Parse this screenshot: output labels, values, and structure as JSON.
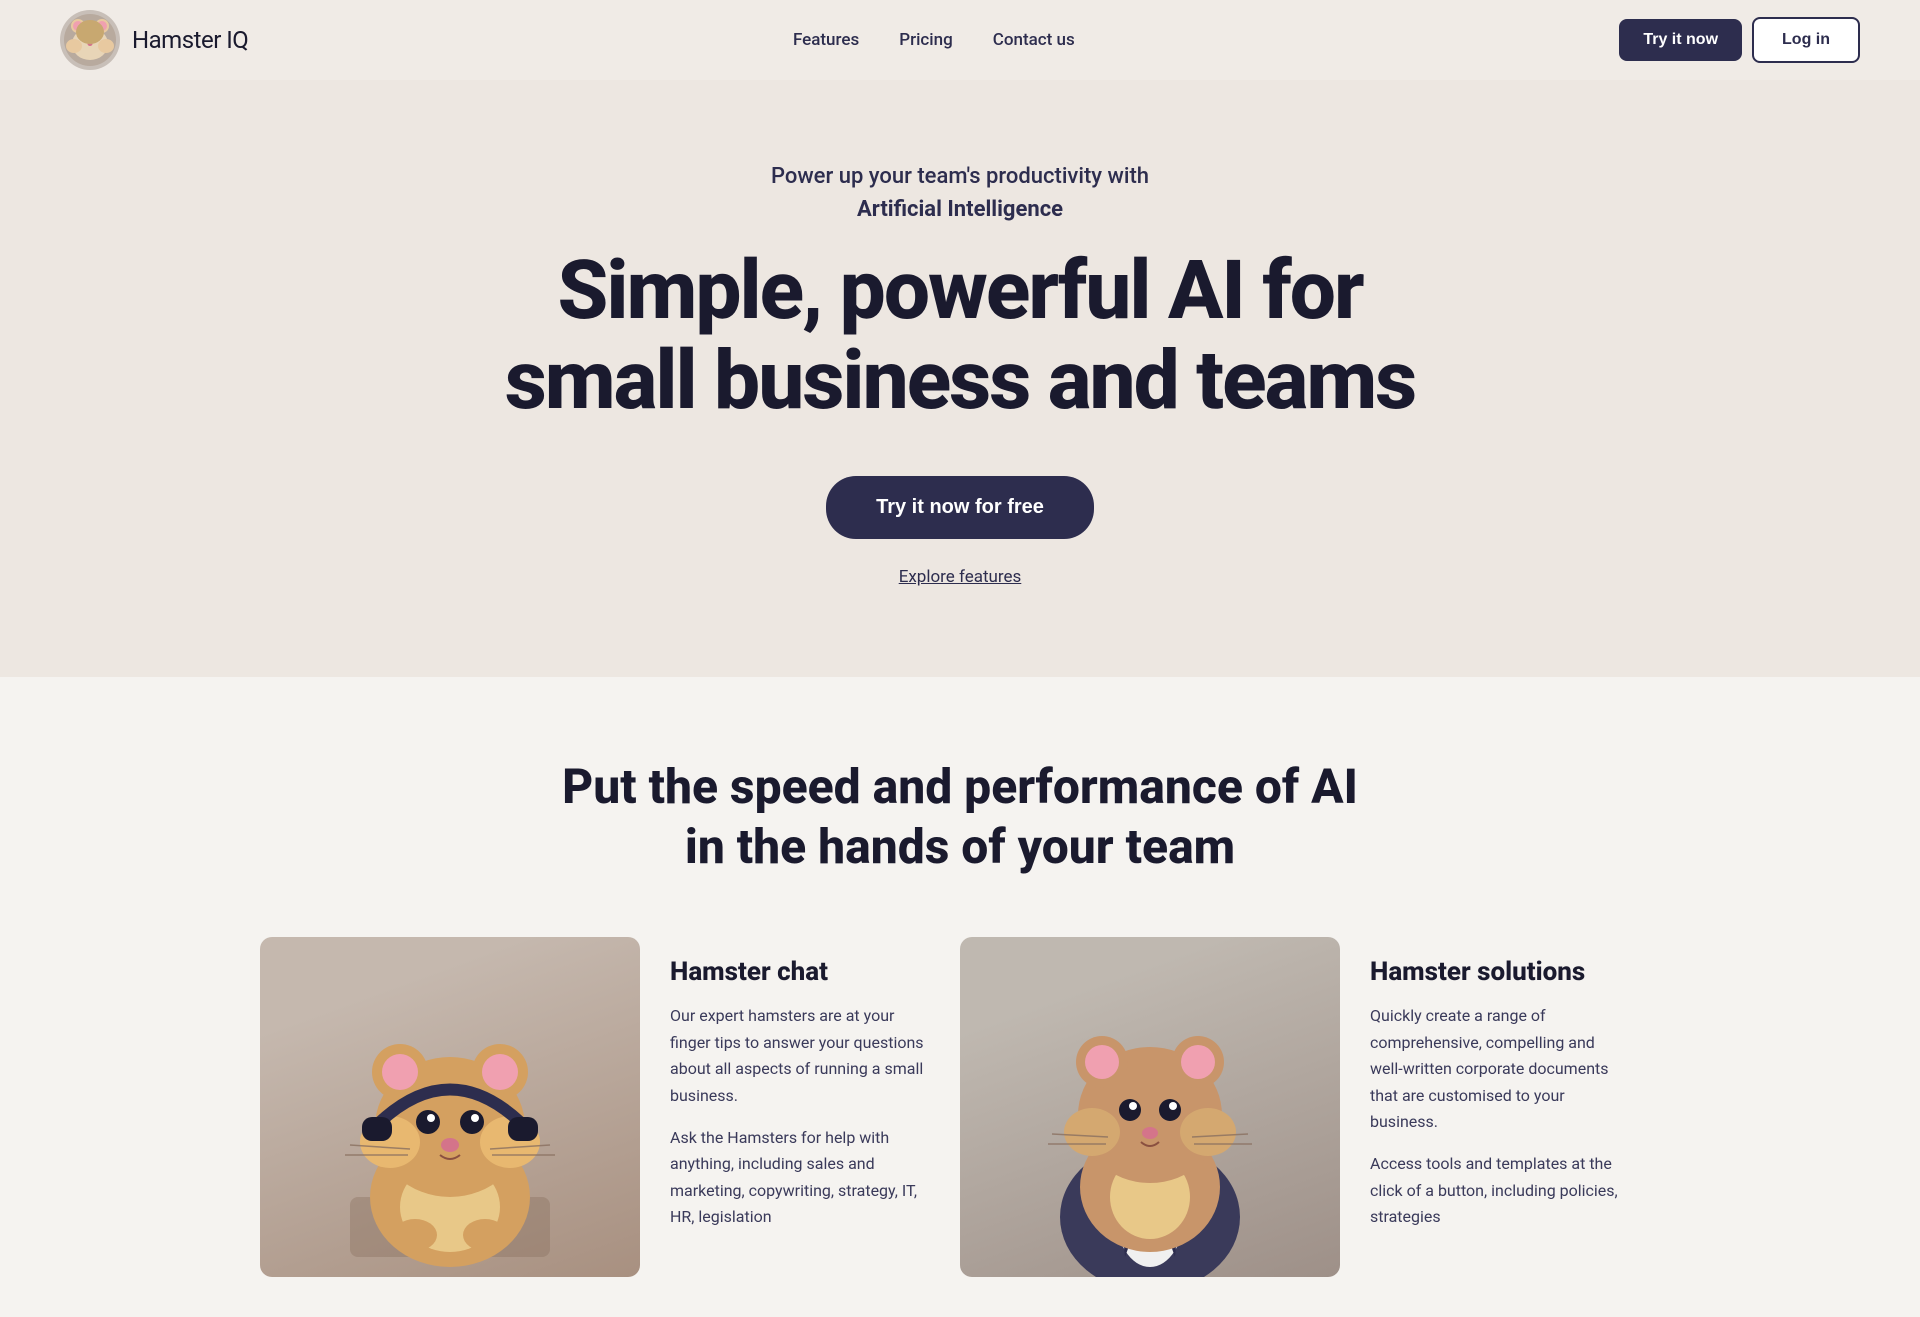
{
  "brand": {
    "logo_emoji": "🐹",
    "name_bold": "Hamster",
    "name_light": " IQ"
  },
  "nav": {
    "links": [
      {
        "id": "features",
        "label": "Features"
      },
      {
        "id": "pricing",
        "label": "Pricing"
      },
      {
        "id": "contact",
        "label": "Contact us"
      }
    ],
    "btn_try": "Try it now",
    "btn_login": "Log in"
  },
  "hero": {
    "tagline_line1": "Power up your team's productivity with",
    "tagline_line2": "Artificial Intelligence",
    "title_line1": "Simple, powerful AI for",
    "title_line2": "small business and teams",
    "cta_button": "Try it now for free",
    "explore_link": "Explore features"
  },
  "features": {
    "section_title_line1": "Put the speed and performance of AI",
    "section_title_line2": "in the hands of your team",
    "cards": [
      {
        "id": "hamster-chat",
        "name": "Hamster chat",
        "desc1": "Our expert hamsters are at your finger tips to answer your questions about all aspects of running a small business.",
        "desc2": "Ask the Hamsters for help with anything, including sales and marketing, copywriting, strategy, IT, HR, legislation"
      },
      {
        "id": "hamster-solutions",
        "name": "Hamster solutions",
        "desc1": "Quickly create a range of comprehensive, compelling and well-written corporate documents that are customised to your business.",
        "desc2": "Access tools and templates at the click of a button, including policies, strategies"
      }
    ]
  },
  "colors": {
    "dark_navy": "#2d2d4e",
    "bg_hero": "#ede7e1",
    "bg_features": "#f5f3f0",
    "text_primary": "#1a1a2e"
  }
}
